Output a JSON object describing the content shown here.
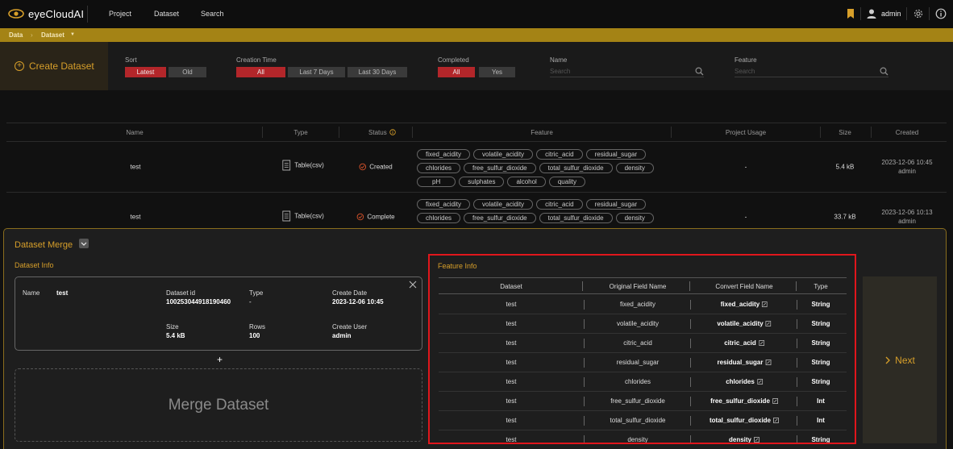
{
  "app": {
    "name": "eyeCloudAI"
  },
  "nav": [
    "Project",
    "Dataset",
    "Search"
  ],
  "user": {
    "name": "admin"
  },
  "breadcrumb": {
    "root": "Data",
    "current": "Dataset"
  },
  "filters": {
    "create_label": "Create Dataset",
    "sort": {
      "label": "Sort",
      "options": [
        "Latest",
        "Old"
      ],
      "selected": "Latest"
    },
    "creation_time": {
      "label": "Creation Time",
      "options": [
        "All",
        "Last 7 Days",
        "Last 30 Days"
      ],
      "selected": "All"
    },
    "completed": {
      "label": "Completed",
      "options": [
        "All",
        "Yes"
      ],
      "selected": "All"
    },
    "name": {
      "label": "Name",
      "placeholder": "Search"
    },
    "feature": {
      "label": "Feature",
      "placeholder": "Search"
    }
  },
  "table": {
    "columns": [
      "Name",
      "Type",
      "Status",
      "Feature",
      "Project Usage",
      "Size",
      "Created"
    ],
    "rows": [
      {
        "name": "test",
        "type": "Table(csv)",
        "status": "Created",
        "features": [
          "fixed_acidity",
          "volatile_acidity",
          "citric_acid",
          "residual_sugar",
          "chlorides",
          "free_sulfur_dioxide",
          "total_sulfur_dioxide",
          "density",
          "pH",
          "sulphates",
          "alcohol",
          "quality"
        ],
        "usage": "-",
        "size": "5.4 kB",
        "created_date": "2023-12-06 10:45",
        "created_user": "admin"
      },
      {
        "name": "test",
        "type": "Table(csv)",
        "status": "Complete",
        "features": [
          "fixed_acidity",
          "volatile_acidity",
          "citric_acid",
          "residual_sugar",
          "chlorides",
          "free_sulfur_dioxide",
          "total_sulfur_dioxide",
          "density"
        ],
        "usage": "-",
        "size": "33.7 kB",
        "created_date": "2023-12-06 10:13",
        "created_user": "admin"
      }
    ]
  },
  "merge": {
    "title": "Dataset Merge",
    "dataset_info_title": "Dataset Info",
    "info": {
      "name_label": "Name",
      "name": "test",
      "id_label": "Dataset id",
      "id": "100253044918190460",
      "type_label": "Type",
      "type": "-",
      "create_date_label": "Create Date",
      "create_date": "2023-12-06 10:45",
      "size_label": "Size",
      "size": "5.4 kB",
      "rows_label": "Rows",
      "rows": "100",
      "create_user_label": "Create User",
      "create_user": "admin"
    },
    "add_label": "+",
    "merge_placeholder": "Merge Dataset",
    "feature_info_title": "Feature Info",
    "feature_columns": [
      "Dataset",
      "Original Field Name",
      "Convert Field Name",
      "Type"
    ],
    "feature_rows": [
      {
        "dataset": "test",
        "original": "fixed_acidity",
        "convert": "fixed_acidity",
        "type": "String"
      },
      {
        "dataset": "test",
        "original": "volatile_acidity",
        "convert": "volatile_acidity",
        "type": "String"
      },
      {
        "dataset": "test",
        "original": "citric_acid",
        "convert": "citric_acid",
        "type": "String"
      },
      {
        "dataset": "test",
        "original": "residual_sugar",
        "convert": "residual_sugar",
        "type": "String"
      },
      {
        "dataset": "test",
        "original": "chlorides",
        "convert": "chlorides",
        "type": "String"
      },
      {
        "dataset": "test",
        "original": "free_sulfur_dioxide",
        "convert": "free_sulfur_dioxide",
        "type": "Int"
      },
      {
        "dataset": "test",
        "original": "total_sulfur_dioxide",
        "convert": "total_sulfur_dioxide",
        "type": "Int"
      },
      {
        "dataset": "test",
        "original": "density",
        "convert": "density",
        "type": "String"
      }
    ],
    "next_label": "Next"
  },
  "colors": {
    "accent": "#d79f2a",
    "breadcrumb_bg": "#a48315",
    "active_filter": "#b3262a",
    "highlight_border": "#e0161c"
  }
}
